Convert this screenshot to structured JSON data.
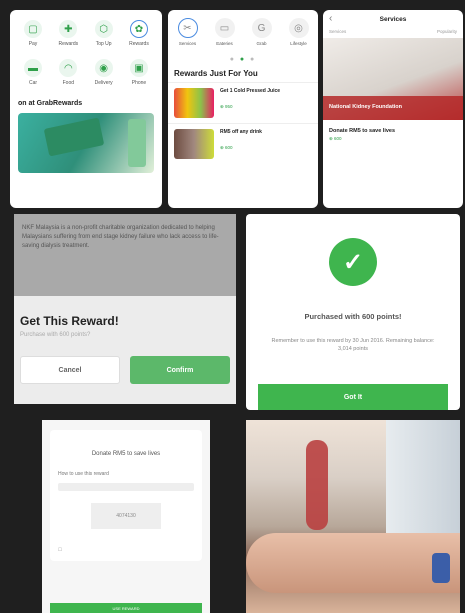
{
  "panel1": {
    "icons": [
      {
        "label": "Pay",
        "icon": "pay-icon"
      },
      {
        "label": "Rewards",
        "icon": "rewards-icon"
      },
      {
        "label": "Top Up",
        "icon": "topup-icon"
      },
      {
        "label": "Rewards",
        "icon": "rewards-selected-icon"
      }
    ],
    "icons2": [
      {
        "label": "Car",
        "icon": "car-icon"
      },
      {
        "label": "Food",
        "icon": "food-icon"
      },
      {
        "label": "Delivery",
        "icon": "delivery-icon"
      },
      {
        "label": "Phone",
        "icon": "phone-icon"
      }
    ],
    "promo_title": "on at GrabRewards"
  },
  "panel2": {
    "tabs": [
      {
        "label": "Services",
        "icon": "services-icon"
      },
      {
        "label": "Eateries",
        "icon": "eateries-icon"
      },
      {
        "label": "Grab",
        "icon": "grab-icon"
      },
      {
        "label": "Lifestyle",
        "icon": "lifestyle-icon"
      }
    ],
    "section_title": "Rewards Just For You",
    "items": [
      {
        "title": "Get 1 Cold Pressed Juice",
        "points": "⊕ 950"
      },
      {
        "title": "RM5 off any drink",
        "points": "⊕ 600"
      }
    ]
  },
  "panel3": {
    "title": "Services",
    "left_label": "Services",
    "right_label": "Popularity",
    "banner": "National Kidney Foundation",
    "reward_title": "Donate RM5 to save lives",
    "points": "⊕ 600"
  },
  "panel4": {
    "desc": "NKF Malaysia is a non-profit charitable organization dedicated to helping Malaysians suffering from end stage kidney failure who lack access to life-saving dialysis treatment.",
    "title": "Get This Reward!",
    "subtitle": "Purchase with 600 points?",
    "cancel": "Cancel",
    "confirm": "Confirm"
  },
  "panel5": {
    "title": "Purchased with 600 points!",
    "note": "Remember to use this reward by 30 Jun 2016. Remaining balance: 3,014 points",
    "button": "Got It"
  },
  "panel6": {
    "heading": "Donate RM5 to save lives",
    "how_to": "How to use this reward",
    "code": "4074130",
    "bar": "USE REWARD"
  },
  "colors": {
    "accent": "#3fb54e",
    "blue": "#4a8be0",
    "red": "#b94040"
  }
}
